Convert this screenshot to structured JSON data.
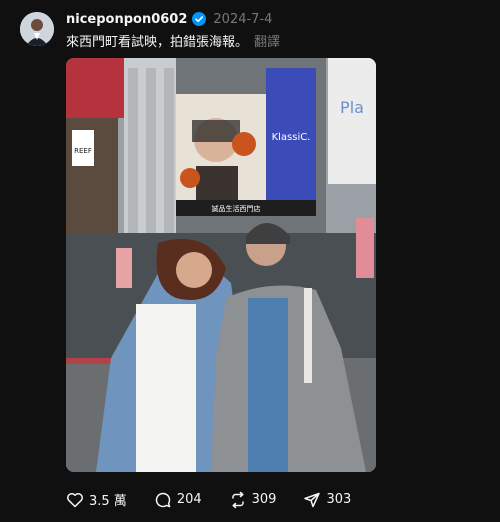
{
  "post": {
    "username": "niceponpon0602",
    "date": "2024-7-4",
    "caption": "來西門町看試映，拍錯張海報。",
    "translate_label": "翻譯",
    "photo": {
      "billboard_text": "KlassiC.",
      "billboard_subtext": "誠品生活西門店",
      "shop_sign": "REEF",
      "corner_sign": "Pla"
    }
  },
  "actions": {
    "likes": "3.5 萬",
    "comments": "204",
    "reposts": "309",
    "shares": "303"
  },
  "colors": {
    "background": "#101010",
    "verified": "#0095f6",
    "muted": "#777777"
  }
}
